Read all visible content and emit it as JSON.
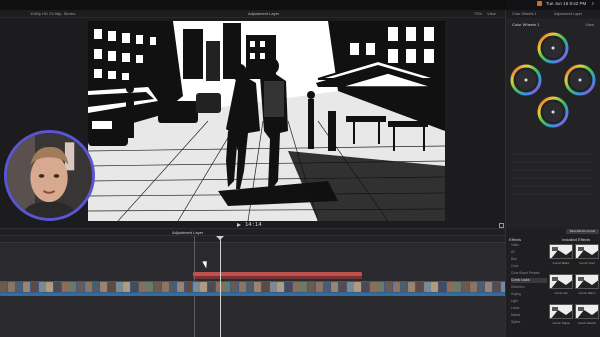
{
  "menubar": {
    "status_text": "Tue Jun 16  8:42 PM"
  },
  "app": {
    "library_label": "1080p HD 23.98p, Stereo",
    "viewer_title": "Adjustment Layer",
    "zoom_label": "73%",
    "view_label": "View"
  },
  "viewer": {
    "timecode": "14:14"
  },
  "inspector": {
    "tabs": [
      "Color Wheels 1",
      "Adjustment Layer"
    ],
    "section_title": "Color Wheels 1",
    "view_menu": "View",
    "params": [
      "",
      "",
      "",
      "",
      "",
      ""
    ]
  },
  "timeline": {
    "clip_label": "Adjustment Layer",
    "clip_duration": "",
    "right_info": "",
    "ruler_ticks": [
      "",
      "",
      "",
      "",
      "",
      "",
      "",
      "",
      "",
      "",
      "",
      "",
      "",
      ""
    ]
  },
  "effects": {
    "header": "Effects",
    "header_right": "Installed Effects",
    "top_button": "Best Effects Found",
    "categories": [
      "Video",
      "All",
      "Blur",
      "Color",
      "Color Board Presets",
      "Comic Looks",
      "Distortion",
      "Keying",
      "Light",
      "Looks",
      "Masks",
      "Stylize"
    ],
    "selected_category_index": 5,
    "thumbs": [
      {
        "label": "Comic Basic"
      },
      {
        "label": "Comic Cool"
      },
      {
        "label": "Comic Ink"
      },
      {
        "label": "Comic Warm"
      },
      {
        "label": "Comic Sepia"
      },
      {
        "label": "Comic Sketch"
      }
    ]
  },
  "colors": {
    "accent": "#5a56d1",
    "adjustment_clip": "#c0504d",
    "video_clip": "#3a5a8a",
    "audio_track": "#2f6fa0",
    "menubar_icon": "#d96a2b"
  }
}
